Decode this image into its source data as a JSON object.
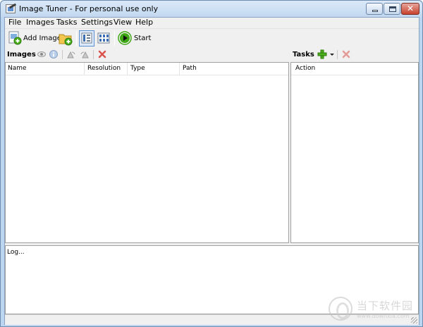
{
  "window": {
    "title": "Image Tuner - For personal use only"
  },
  "menu": [
    "File",
    "Images",
    "Tasks",
    "Settings",
    "View",
    "Help"
  ],
  "toolbar": {
    "add_images": "Add Images",
    "start": "Start"
  },
  "images_panel": {
    "title": "Images",
    "columns": [
      "Name",
      "Resolution",
      "Type",
      "Path"
    ]
  },
  "tasks_panel": {
    "title": "Tasks",
    "columns": [
      "Action"
    ]
  },
  "log": {
    "text": "Log..."
  },
  "watermark": {
    "text": "当下软件园",
    "sub": "www.downxia.com"
  },
  "colors": {
    "titlebar": "#c9dcf2",
    "close": "#c8412e",
    "add_green": "#4caf1e",
    "delete_red": "#d9534f",
    "start_green": "#3ea814"
  }
}
